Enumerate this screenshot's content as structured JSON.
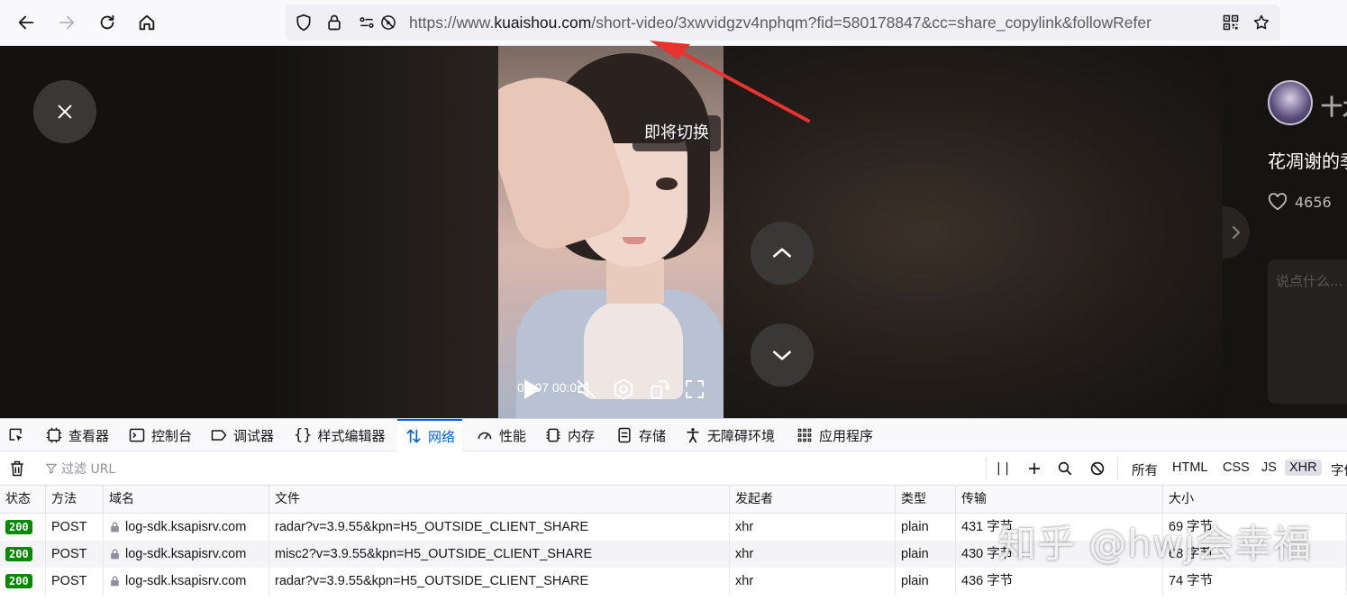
{
  "browser": {
    "url_prefix": "https://www.",
    "url_domain": "kuaishou.com",
    "url_rest": "/short-video/3xwvidgzv4nphqm?fid=580178847&cc=share_copylink&followRefer"
  },
  "video": {
    "tooltip": "即将切换",
    "time": "00:07 00:0",
    "side": {
      "follow": "十九",
      "title": "花凋谢的季",
      "likes": "4656",
      "comment_placeholder": "说点什么..."
    }
  },
  "devtools": {
    "tabs": [
      "查看器",
      "控制台",
      "调试器",
      "样式编辑器",
      "网络",
      "性能",
      "内存",
      "存储",
      "无障碍环境",
      "应用程序"
    ],
    "active_tab": "网络",
    "filter_placeholder": "过滤 URL",
    "pause_label": "| |",
    "type_filters": [
      "所有",
      "HTML",
      "CSS",
      "JS",
      "XHR",
      "字体"
    ],
    "selected_type": "XHR",
    "columns": [
      "状态",
      "方法",
      "域名",
      "文件",
      "发起者",
      "类型",
      "传输",
      "大小"
    ],
    "rows": [
      {
        "status": "200",
        "method": "POST",
        "domain": "log-sdk.ksapisrv.com",
        "file": "radar?v=3.9.55&kpn=H5_OUTSIDE_CLIENT_SHARE",
        "initiator": "xhr",
        "type": "plain",
        "transfer": "431 字节",
        "size": "69 字节"
      },
      {
        "status": "200",
        "method": "POST",
        "domain": "log-sdk.ksapisrv.com",
        "file": "misc2?v=3.9.55&kpn=H5_OUTSIDE_CLIENT_SHARE",
        "initiator": "xhr",
        "type": "plain",
        "transfer": "430 字节",
        "size": "68 字节"
      },
      {
        "status": "200",
        "method": "POST",
        "domain": "log-sdk.ksapisrv.com",
        "file": "radar?v=3.9.55&kpn=H5_OUTSIDE_CLIENT_SHARE",
        "initiator": "xhr",
        "type": "plain",
        "transfer": "436 字节",
        "size": "74 字节"
      }
    ]
  },
  "watermark": "知乎 @hwj会幸福",
  "colors": {
    "accent": "#0061e0",
    "status_ok": "#058b00",
    "annotation_arrow": "#e8332e"
  }
}
